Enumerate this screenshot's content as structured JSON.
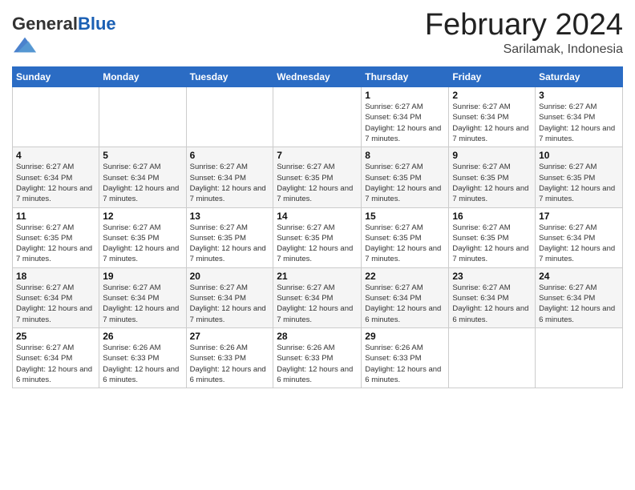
{
  "logo": {
    "general": "General",
    "blue": "Blue"
  },
  "header": {
    "month": "February 2024",
    "location": "Sarilamak, Indonesia"
  },
  "weekdays": [
    "Sunday",
    "Monday",
    "Tuesday",
    "Wednesday",
    "Thursday",
    "Friday",
    "Saturday"
  ],
  "weeks": [
    [
      {
        "day": "",
        "info": ""
      },
      {
        "day": "",
        "info": ""
      },
      {
        "day": "",
        "info": ""
      },
      {
        "day": "",
        "info": ""
      },
      {
        "day": "1",
        "info": "Sunrise: 6:27 AM\nSunset: 6:34 PM\nDaylight: 12 hours and 7 minutes."
      },
      {
        "day": "2",
        "info": "Sunrise: 6:27 AM\nSunset: 6:34 PM\nDaylight: 12 hours and 7 minutes."
      },
      {
        "day": "3",
        "info": "Sunrise: 6:27 AM\nSunset: 6:34 PM\nDaylight: 12 hours and 7 minutes."
      }
    ],
    [
      {
        "day": "4",
        "info": "Sunrise: 6:27 AM\nSunset: 6:34 PM\nDaylight: 12 hours and 7 minutes."
      },
      {
        "day": "5",
        "info": "Sunrise: 6:27 AM\nSunset: 6:34 PM\nDaylight: 12 hours and 7 minutes."
      },
      {
        "day": "6",
        "info": "Sunrise: 6:27 AM\nSunset: 6:34 PM\nDaylight: 12 hours and 7 minutes."
      },
      {
        "day": "7",
        "info": "Sunrise: 6:27 AM\nSunset: 6:35 PM\nDaylight: 12 hours and 7 minutes."
      },
      {
        "day": "8",
        "info": "Sunrise: 6:27 AM\nSunset: 6:35 PM\nDaylight: 12 hours and 7 minutes."
      },
      {
        "day": "9",
        "info": "Sunrise: 6:27 AM\nSunset: 6:35 PM\nDaylight: 12 hours and 7 minutes."
      },
      {
        "day": "10",
        "info": "Sunrise: 6:27 AM\nSunset: 6:35 PM\nDaylight: 12 hours and 7 minutes."
      }
    ],
    [
      {
        "day": "11",
        "info": "Sunrise: 6:27 AM\nSunset: 6:35 PM\nDaylight: 12 hours and 7 minutes."
      },
      {
        "day": "12",
        "info": "Sunrise: 6:27 AM\nSunset: 6:35 PM\nDaylight: 12 hours and 7 minutes."
      },
      {
        "day": "13",
        "info": "Sunrise: 6:27 AM\nSunset: 6:35 PM\nDaylight: 12 hours and 7 minutes."
      },
      {
        "day": "14",
        "info": "Sunrise: 6:27 AM\nSunset: 6:35 PM\nDaylight: 12 hours and 7 minutes."
      },
      {
        "day": "15",
        "info": "Sunrise: 6:27 AM\nSunset: 6:35 PM\nDaylight: 12 hours and 7 minutes."
      },
      {
        "day": "16",
        "info": "Sunrise: 6:27 AM\nSunset: 6:35 PM\nDaylight: 12 hours and 7 minutes."
      },
      {
        "day": "17",
        "info": "Sunrise: 6:27 AM\nSunset: 6:34 PM\nDaylight: 12 hours and 7 minutes."
      }
    ],
    [
      {
        "day": "18",
        "info": "Sunrise: 6:27 AM\nSunset: 6:34 PM\nDaylight: 12 hours and 7 minutes."
      },
      {
        "day": "19",
        "info": "Sunrise: 6:27 AM\nSunset: 6:34 PM\nDaylight: 12 hours and 7 minutes."
      },
      {
        "day": "20",
        "info": "Sunrise: 6:27 AM\nSunset: 6:34 PM\nDaylight: 12 hours and 7 minutes."
      },
      {
        "day": "21",
        "info": "Sunrise: 6:27 AM\nSunset: 6:34 PM\nDaylight: 12 hours and 7 minutes."
      },
      {
        "day": "22",
        "info": "Sunrise: 6:27 AM\nSunset: 6:34 PM\nDaylight: 12 hours and 6 minutes."
      },
      {
        "day": "23",
        "info": "Sunrise: 6:27 AM\nSunset: 6:34 PM\nDaylight: 12 hours and 6 minutes."
      },
      {
        "day": "24",
        "info": "Sunrise: 6:27 AM\nSunset: 6:34 PM\nDaylight: 12 hours and 6 minutes."
      }
    ],
    [
      {
        "day": "25",
        "info": "Sunrise: 6:27 AM\nSunset: 6:34 PM\nDaylight: 12 hours and 6 minutes."
      },
      {
        "day": "26",
        "info": "Sunrise: 6:26 AM\nSunset: 6:33 PM\nDaylight: 12 hours and 6 minutes."
      },
      {
        "day": "27",
        "info": "Sunrise: 6:26 AM\nSunset: 6:33 PM\nDaylight: 12 hours and 6 minutes."
      },
      {
        "day": "28",
        "info": "Sunrise: 6:26 AM\nSunset: 6:33 PM\nDaylight: 12 hours and 6 minutes."
      },
      {
        "day": "29",
        "info": "Sunrise: 6:26 AM\nSunset: 6:33 PM\nDaylight: 12 hours and 6 minutes."
      },
      {
        "day": "",
        "info": ""
      },
      {
        "day": "",
        "info": ""
      }
    ]
  ]
}
